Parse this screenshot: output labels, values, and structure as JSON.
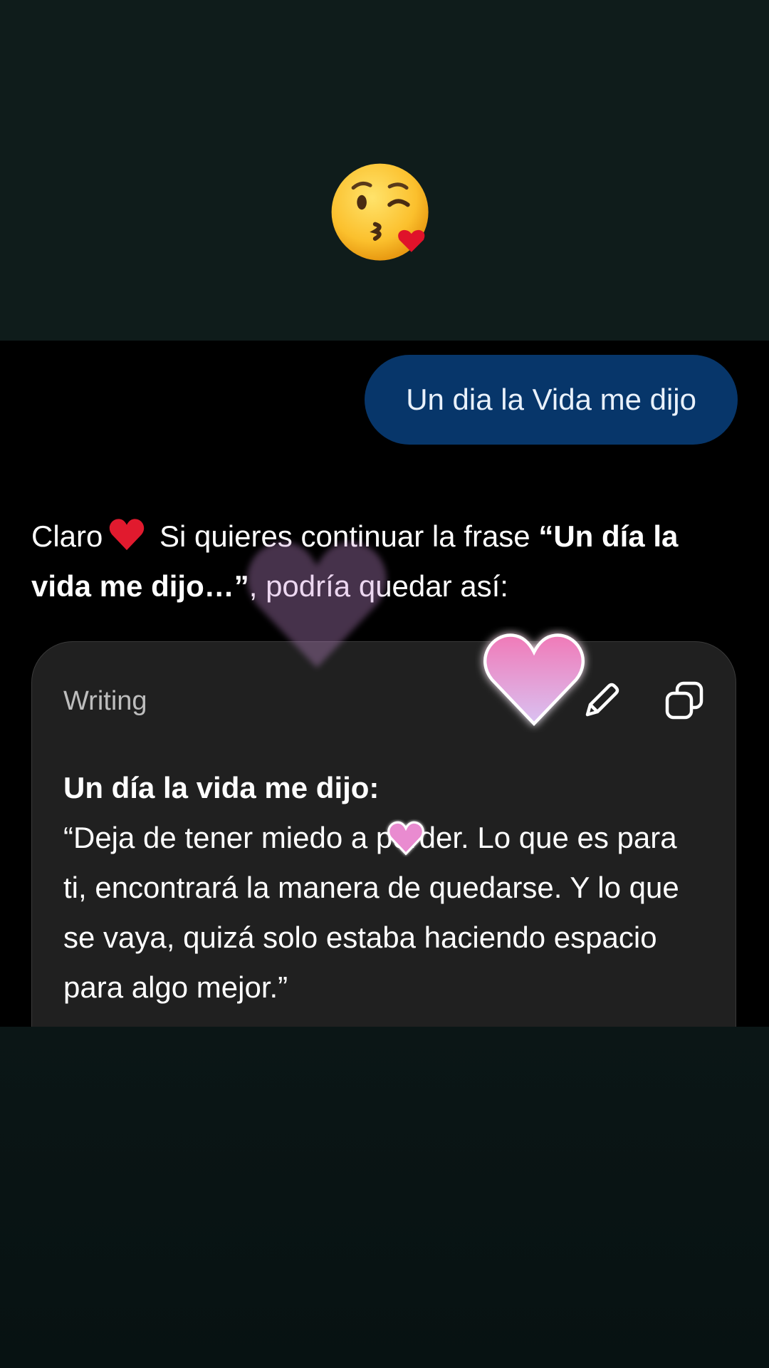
{
  "top_emoji": {
    "icon": "face-blowing-kiss-icon",
    "alt": "face blowing a kiss"
  },
  "user_message": {
    "text": "Un dia la Vida me dijo"
  },
  "reply": {
    "intro": "Claro",
    "heart_icon": "red-heart-icon",
    "text_before_quote": " Si quieres continuar la frase ",
    "quote": "“Un día la vida me dijo…”",
    "text_after_quote": ", podría quedar así:"
  },
  "writing_card": {
    "label": "Writing",
    "edit_icon": "pencil-icon",
    "copy_icon": "copy-icon",
    "title": "Un día la vida me dijo:",
    "body": "“Deja de tener miedo a perder. Lo que es para ti, encontrará la manera de quedarse. Y lo que se vaya, quizá solo estaba haciendo espacio para algo mejor.”"
  },
  "colors": {
    "user_bubble": "#07366a",
    "card_background": "#202020",
    "chat_background": "#000000",
    "frame_background": "#0f1c1b"
  }
}
